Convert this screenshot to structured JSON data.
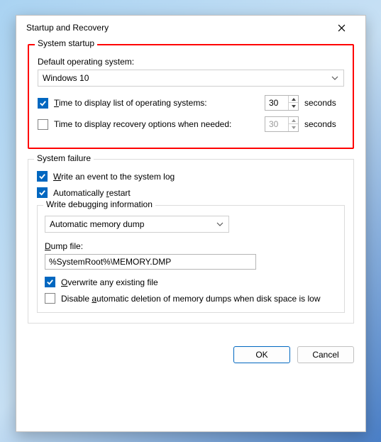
{
  "window": {
    "title": "Startup and Recovery"
  },
  "startup": {
    "group_title": "System startup",
    "default_os_label": "Default operating system:",
    "default_os_value": "Windows 10",
    "time_list_label_pre": "T",
    "time_list_label_post": "ime to display list of operating systems:",
    "time_list_value": "30",
    "time_list_checked": true,
    "time_recovery_label": "Time to display recovery options when needed:",
    "time_recovery_value": "30",
    "time_recovery_checked": false,
    "seconds_unit": "seconds"
  },
  "failure": {
    "group_title": "System failure",
    "write_event_pre": "W",
    "write_event_post": "rite an event to the system log",
    "write_event_checked": true,
    "auto_restart_pre": "Automatically ",
    "auto_restart_u": "r",
    "auto_restart_post": "estart",
    "auto_restart_checked": true,
    "debug_group_title": "Write debugging information",
    "debug_type": "Automatic memory dump",
    "dump_file_label_pre": "D",
    "dump_file_label_post": "ump file:",
    "dump_file_value": "%SystemRoot%\\MEMORY.DMP",
    "overwrite_pre": "O",
    "overwrite_post": "verwrite any existing file",
    "overwrite_checked": true,
    "disable_del_pre": "Disable ",
    "disable_del_u": "a",
    "disable_del_post": "utomatic deletion of memory dumps when disk space is low",
    "disable_del_checked": false
  },
  "buttons": {
    "ok": "OK",
    "cancel": "Cancel"
  }
}
